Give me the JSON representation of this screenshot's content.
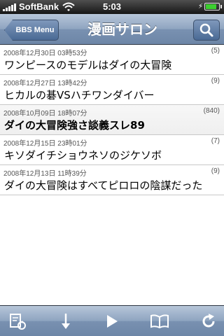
{
  "status_bar": {
    "carrier": "SoftBank",
    "time": "5:03",
    "battery_level": 0.85
  },
  "nav": {
    "back_label": "BBS Menu",
    "title": "漫画サロン",
    "search_icon": "search-icon"
  },
  "threads": [
    {
      "date": "2008年12月30日 03時53分",
      "count": "(5)",
      "title": "ワンピースのモデルはダイの大冒険"
    },
    {
      "date": "2008年12月27日 13時42分",
      "count": "(9)",
      "title": "ヒカルの碁VSハチワンダイバー"
    },
    {
      "date": "2008年10月09日 18時07分",
      "count": "(840)",
      "title": "ダイの大冒険強さ談義スレ89"
    },
    {
      "date": "2008年12月15日 23時01分",
      "count": "(7)",
      "title": "キソダイチショウネソのジケソボ"
    },
    {
      "date": "2008年12月13日 11時39分",
      "count": "(9)",
      "title": "ダイの大冒険はすべてピロロの陰謀だった"
    }
  ],
  "toolbar": {
    "icons": [
      "edit-recycle-icon",
      "arrow-down-icon",
      "play-icon",
      "book-icon",
      "refresh-icon"
    ]
  }
}
